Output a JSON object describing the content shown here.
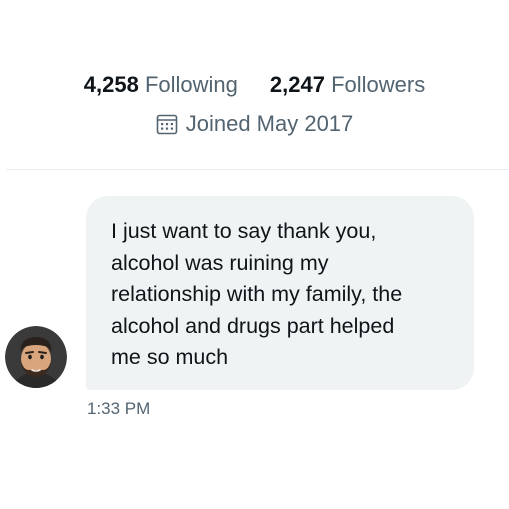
{
  "profile": {
    "following_count": "4,258",
    "following_label": "Following",
    "followers_count": "2,247",
    "followers_label": "Followers",
    "joined_text": "Joined May 2017",
    "calendar_icon": "calendar-icon"
  },
  "message": {
    "lines": [
      "I just want to say thank you,",
      "alcohol was ruining my",
      "relationship with my family, the",
      "alcohol and drugs part helped",
      "me so much"
    ],
    "timestamp": "1:33 PM",
    "avatar": "memoji-avatar"
  },
  "colors": {
    "text_primary": "#0f1419",
    "text_secondary": "#536471",
    "bubble_bg": "#eff3f4",
    "divider": "#e6ecf0"
  }
}
